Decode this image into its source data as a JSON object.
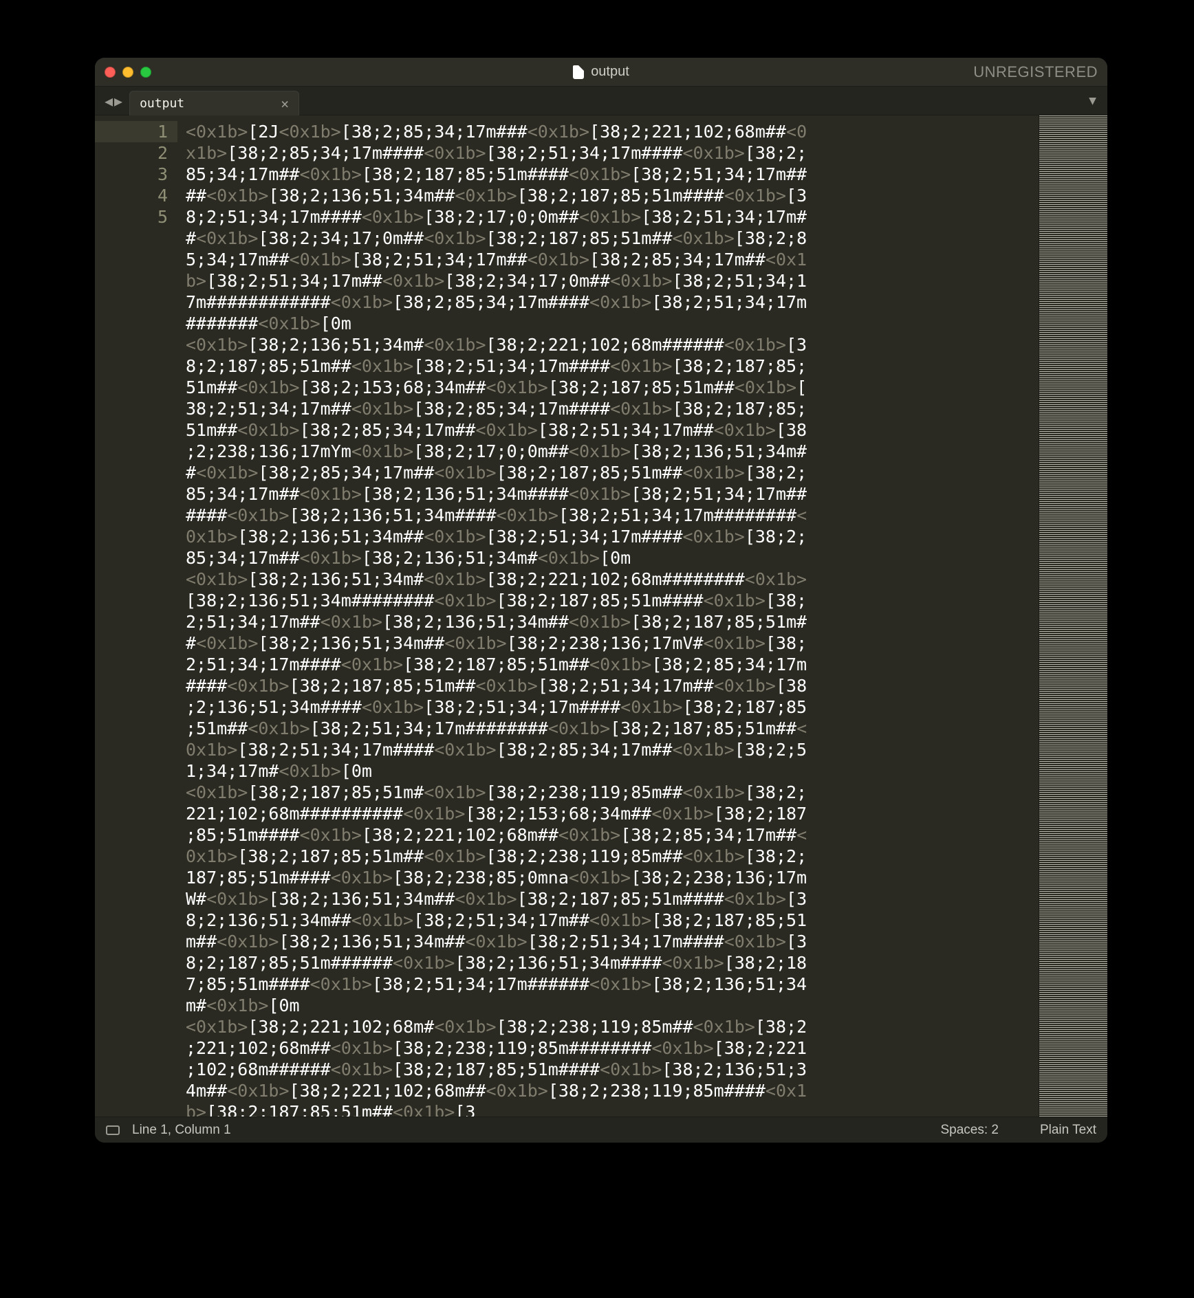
{
  "title": "output",
  "unregistered": "UNREGISTERED",
  "tab": {
    "label": "output",
    "close": "×"
  },
  "tabs_menu_glyph": "▼",
  "nav": {
    "back": "◀",
    "forward": "▶"
  },
  "status": {
    "position": "Line 1, Column 1",
    "spaces": "Spaces: 2",
    "syntax": "Plain Text"
  },
  "lines": [
    {
      "n": "1",
      "cursor": true,
      "segments": [
        {
          "t": "esc",
          "v": "<0x1b>"
        },
        {
          "t": "txt",
          "v": "[2J"
        },
        {
          "t": "esc",
          "v": "<0x1b>"
        },
        {
          "t": "txt",
          "v": "[38;2;85;34;17m###"
        },
        {
          "t": "esc",
          "v": "<0x1b>"
        },
        {
          "t": "txt",
          "v": "[38;2;221;102;68m##"
        },
        {
          "t": "esc",
          "v": "<0x1b>"
        },
        {
          "t": "txt",
          "v": "[38;2;85;34;17m####"
        },
        {
          "t": "esc",
          "v": "<0x1b>"
        },
        {
          "t": "txt",
          "v": "[38;2;51;34;17m####"
        },
        {
          "t": "esc",
          "v": "<0x1b>"
        },
        {
          "t": "txt",
          "v": "[38;2;85;34;17m##"
        },
        {
          "t": "esc",
          "v": "<0x1b>"
        },
        {
          "t": "txt",
          "v": "[38;2;187;85;51m####"
        },
        {
          "t": "esc",
          "v": "<0x1b>"
        },
        {
          "t": "txt",
          "v": "[38;2;51;34;17m####"
        },
        {
          "t": "esc",
          "v": "<0x1b>"
        },
        {
          "t": "txt",
          "v": "[38;2;136;51;34m##"
        },
        {
          "t": "esc",
          "v": "<0x1b>"
        },
        {
          "t": "txt",
          "v": "[38;2;187;85;51m####"
        },
        {
          "t": "esc",
          "v": "<0x1b>"
        },
        {
          "t": "txt",
          "v": "[38;2;51;34;17m####"
        },
        {
          "t": "esc",
          "v": "<0x1b>"
        },
        {
          "t": "txt",
          "v": "[38;2;17;0;0m##"
        },
        {
          "t": "esc",
          "v": "<0x1b>"
        },
        {
          "t": "txt",
          "v": "[38;2;51;34;17m##"
        },
        {
          "t": "esc",
          "v": "<0x1b>"
        },
        {
          "t": "txt",
          "v": "[38;2;34;17;0m##"
        },
        {
          "t": "esc",
          "v": "<0x1b>"
        },
        {
          "t": "txt",
          "v": "[38;2;187;85;51m##"
        },
        {
          "t": "esc",
          "v": "<0x1b>"
        },
        {
          "t": "txt",
          "v": "[38;2;85;34;17m##"
        },
        {
          "t": "esc",
          "v": "<0x1b>"
        },
        {
          "t": "txt",
          "v": "[38;2;51;34;17m##"
        },
        {
          "t": "esc",
          "v": "<0x1b>"
        },
        {
          "t": "txt",
          "v": "[38;2;85;34;17m##"
        },
        {
          "t": "esc",
          "v": "<0x1b>"
        },
        {
          "t": "txt",
          "v": "[38;2;51;34;17m##"
        },
        {
          "t": "esc",
          "v": "<0x1b>"
        },
        {
          "t": "txt",
          "v": "[38;2;34;17;0m##"
        },
        {
          "t": "esc",
          "v": "<0x1b>"
        },
        {
          "t": "txt",
          "v": "[38;2;51;34;17m############"
        },
        {
          "t": "esc",
          "v": "<0x1b>"
        },
        {
          "t": "txt",
          "v": "[38;2;85;34;17m####"
        },
        {
          "t": "esc",
          "v": "<0x1b>"
        },
        {
          "t": "txt",
          "v": "[38;2;51;34;17m#######"
        },
        {
          "t": "esc",
          "v": "<0x1b>"
        },
        {
          "t": "txt",
          "v": "[0m"
        }
      ]
    },
    {
      "n": "2",
      "segments": [
        {
          "t": "esc",
          "v": "<0x1b>"
        },
        {
          "t": "txt",
          "v": "[38;2;136;51;34m#"
        },
        {
          "t": "esc",
          "v": "<0x1b>"
        },
        {
          "t": "txt",
          "v": "[38;2;221;102;68m######"
        },
        {
          "t": "esc",
          "v": "<0x1b>"
        },
        {
          "t": "txt",
          "v": "[38;2;187;85;51m##"
        },
        {
          "t": "esc",
          "v": "<0x1b>"
        },
        {
          "t": "txt",
          "v": "[38;2;51;34;17m####"
        },
        {
          "t": "esc",
          "v": "<0x1b>"
        },
        {
          "t": "txt",
          "v": "[38;2;187;85;51m##"
        },
        {
          "t": "esc",
          "v": "<0x1b>"
        },
        {
          "t": "txt",
          "v": "[38;2;153;68;34m##"
        },
        {
          "t": "esc",
          "v": "<0x1b>"
        },
        {
          "t": "txt",
          "v": "[38;2;187;85;51m##"
        },
        {
          "t": "esc",
          "v": "<0x1b>"
        },
        {
          "t": "txt",
          "v": "[38;2;51;34;17m##"
        },
        {
          "t": "esc",
          "v": "<0x1b>"
        },
        {
          "t": "txt",
          "v": "[38;2;85;34;17m####"
        },
        {
          "t": "esc",
          "v": "<0x1b>"
        },
        {
          "t": "txt",
          "v": "[38;2;187;85;51m##"
        },
        {
          "t": "esc",
          "v": "<0x1b>"
        },
        {
          "t": "txt",
          "v": "[38;2;85;34;17m##"
        },
        {
          "t": "esc",
          "v": "<0x1b>"
        },
        {
          "t": "txt",
          "v": "[38;2;51;34;17m##"
        },
        {
          "t": "esc",
          "v": "<0x1b>"
        },
        {
          "t": "txt",
          "v": "[38;2;238;136;17mYm"
        },
        {
          "t": "esc",
          "v": "<0x1b>"
        },
        {
          "t": "txt",
          "v": "[38;2;17;0;0m##"
        },
        {
          "t": "esc",
          "v": "<0x1b>"
        },
        {
          "t": "txt",
          "v": "[38;2;136;51;34m##"
        },
        {
          "t": "esc",
          "v": "<0x1b>"
        },
        {
          "t": "txt",
          "v": "[38;2;85;34;17m##"
        },
        {
          "t": "esc",
          "v": "<0x1b>"
        },
        {
          "t": "txt",
          "v": "[38;2;187;85;51m##"
        },
        {
          "t": "esc",
          "v": "<0x1b>"
        },
        {
          "t": "txt",
          "v": "[38;2;85;34;17m##"
        },
        {
          "t": "esc",
          "v": "<0x1b>"
        },
        {
          "t": "txt",
          "v": "[38;2;136;51;34m####"
        },
        {
          "t": "esc",
          "v": "<0x1b>"
        },
        {
          "t": "txt",
          "v": "[38;2;51;34;17m######"
        },
        {
          "t": "esc",
          "v": "<0x1b>"
        },
        {
          "t": "txt",
          "v": "[38;2;136;51;34m####"
        },
        {
          "t": "esc",
          "v": "<0x1b>"
        },
        {
          "t": "txt",
          "v": "[38;2;51;34;17m########"
        },
        {
          "t": "esc",
          "v": "<0x1b>"
        },
        {
          "t": "txt",
          "v": "[38;2;136;51;34m##"
        },
        {
          "t": "esc",
          "v": "<0x1b>"
        },
        {
          "t": "txt",
          "v": "[38;2;51;34;17m####"
        },
        {
          "t": "esc",
          "v": "<0x1b>"
        },
        {
          "t": "txt",
          "v": "[38;2;85;34;17m##"
        },
        {
          "t": "esc",
          "v": "<0x1b>"
        },
        {
          "t": "txt",
          "v": "[38;2;136;51;34m#"
        },
        {
          "t": "esc",
          "v": "<0x1b>"
        },
        {
          "t": "txt",
          "v": "[0m"
        }
      ]
    },
    {
      "n": "3",
      "segments": [
        {
          "t": "esc",
          "v": "<0x1b>"
        },
        {
          "t": "txt",
          "v": "[38;2;136;51;34m#"
        },
        {
          "t": "esc",
          "v": "<0x1b>"
        },
        {
          "t": "txt",
          "v": "[38;2;221;102;68m########"
        },
        {
          "t": "esc",
          "v": "<0x1b>"
        },
        {
          "t": "txt",
          "v": "[38;2;136;51;34m########"
        },
        {
          "t": "esc",
          "v": "<0x1b>"
        },
        {
          "t": "txt",
          "v": "[38;2;187;85;51m####"
        },
        {
          "t": "esc",
          "v": "<0x1b>"
        },
        {
          "t": "txt",
          "v": "[38;2;51;34;17m##"
        },
        {
          "t": "esc",
          "v": "<0x1b>"
        },
        {
          "t": "txt",
          "v": "[38;2;136;51;34m##"
        },
        {
          "t": "esc",
          "v": "<0x1b>"
        },
        {
          "t": "txt",
          "v": "[38;2;187;85;51m##"
        },
        {
          "t": "esc",
          "v": "<0x1b>"
        },
        {
          "t": "txt",
          "v": "[38;2;136;51;34m##"
        },
        {
          "t": "esc",
          "v": "<0x1b>"
        },
        {
          "t": "txt",
          "v": "[38;2;238;136;17mV#"
        },
        {
          "t": "esc",
          "v": "<0x1b>"
        },
        {
          "t": "txt",
          "v": "[38;2;51;34;17m####"
        },
        {
          "t": "esc",
          "v": "<0x1b>"
        },
        {
          "t": "txt",
          "v": "[38;2;187;85;51m##"
        },
        {
          "t": "esc",
          "v": "<0x1b>"
        },
        {
          "t": "txt",
          "v": "[38;2;85;34;17m####"
        },
        {
          "t": "esc",
          "v": "<0x1b>"
        },
        {
          "t": "txt",
          "v": "[38;2;187;85;51m##"
        },
        {
          "t": "esc",
          "v": "<0x1b>"
        },
        {
          "t": "txt",
          "v": "[38;2;51;34;17m##"
        },
        {
          "t": "esc",
          "v": "<0x1b>"
        },
        {
          "t": "txt",
          "v": "[38;2;136;51;34m####"
        },
        {
          "t": "esc",
          "v": "<0x1b>"
        },
        {
          "t": "txt",
          "v": "[38;2;51;34;17m####"
        },
        {
          "t": "esc",
          "v": "<0x1b>"
        },
        {
          "t": "txt",
          "v": "[38;2;187;85;51m##"
        },
        {
          "t": "esc",
          "v": "<0x1b>"
        },
        {
          "t": "txt",
          "v": "[38;2;51;34;17m########"
        },
        {
          "t": "esc",
          "v": "<0x1b>"
        },
        {
          "t": "txt",
          "v": "[38;2;187;85;51m##"
        },
        {
          "t": "esc",
          "v": "<0x1b>"
        },
        {
          "t": "txt",
          "v": "[38;2;51;34;17m####"
        },
        {
          "t": "esc",
          "v": "<0x1b>"
        },
        {
          "t": "txt",
          "v": "[38;2;85;34;17m##"
        },
        {
          "t": "esc",
          "v": "<0x1b>"
        },
        {
          "t": "txt",
          "v": "[38;2;51;34;17m#"
        },
        {
          "t": "esc",
          "v": "<0x1b>"
        },
        {
          "t": "txt",
          "v": "[0m"
        }
      ]
    },
    {
      "n": "4",
      "segments": [
        {
          "t": "esc",
          "v": "<0x1b>"
        },
        {
          "t": "txt",
          "v": "[38;2;187;85;51m#"
        },
        {
          "t": "esc",
          "v": "<0x1b>"
        },
        {
          "t": "txt",
          "v": "[38;2;238;119;85m##"
        },
        {
          "t": "esc",
          "v": "<0x1b>"
        },
        {
          "t": "txt",
          "v": "[38;2;221;102;68m##########"
        },
        {
          "t": "esc",
          "v": "<0x1b>"
        },
        {
          "t": "txt",
          "v": "[38;2;153;68;34m##"
        },
        {
          "t": "esc",
          "v": "<0x1b>"
        },
        {
          "t": "txt",
          "v": "[38;2;187;85;51m####"
        },
        {
          "t": "esc",
          "v": "<0x1b>"
        },
        {
          "t": "txt",
          "v": "[38;2;221;102;68m##"
        },
        {
          "t": "esc",
          "v": "<0x1b>"
        },
        {
          "t": "txt",
          "v": "[38;2;85;34;17m##"
        },
        {
          "t": "esc",
          "v": "<0x1b>"
        },
        {
          "t": "txt",
          "v": "[38;2;187;85;51m##"
        },
        {
          "t": "esc",
          "v": "<0x1b>"
        },
        {
          "t": "txt",
          "v": "[38;2;238;119;85m##"
        },
        {
          "t": "esc",
          "v": "<0x1b>"
        },
        {
          "t": "txt",
          "v": "[38;2;187;85;51m####"
        },
        {
          "t": "esc",
          "v": "<0x1b>"
        },
        {
          "t": "txt",
          "v": "[38;2;238;85;0mna"
        },
        {
          "t": "esc",
          "v": "<0x1b>"
        },
        {
          "t": "txt",
          "v": "[38;2;238;136;17mW#"
        },
        {
          "t": "esc",
          "v": "<0x1b>"
        },
        {
          "t": "txt",
          "v": "[38;2;136;51;34m##"
        },
        {
          "t": "esc",
          "v": "<0x1b>"
        },
        {
          "t": "txt",
          "v": "[38;2;187;85;51m####"
        },
        {
          "t": "esc",
          "v": "<0x1b>"
        },
        {
          "t": "txt",
          "v": "[38;2;136;51;34m##"
        },
        {
          "t": "esc",
          "v": "<0x1b>"
        },
        {
          "t": "txt",
          "v": "[38;2;51;34;17m##"
        },
        {
          "t": "esc",
          "v": "<0x1b>"
        },
        {
          "t": "txt",
          "v": "[38;2;187;85;51m##"
        },
        {
          "t": "esc",
          "v": "<0x1b>"
        },
        {
          "t": "txt",
          "v": "[38;2;136;51;34m##"
        },
        {
          "t": "esc",
          "v": "<0x1b>"
        },
        {
          "t": "txt",
          "v": "[38;2;51;34;17m####"
        },
        {
          "t": "esc",
          "v": "<0x1b>"
        },
        {
          "t": "txt",
          "v": "[38;2;187;85;51m######"
        },
        {
          "t": "esc",
          "v": "<0x1b>"
        },
        {
          "t": "txt",
          "v": "[38;2;136;51;34m####"
        },
        {
          "t": "esc",
          "v": "<0x1b>"
        },
        {
          "t": "txt",
          "v": "[38;2;187;85;51m####"
        },
        {
          "t": "esc",
          "v": "<0x1b>"
        },
        {
          "t": "txt",
          "v": "[38;2;51;34;17m######"
        },
        {
          "t": "esc",
          "v": "<0x1b>"
        },
        {
          "t": "txt",
          "v": "[38;2;136;51;34m#"
        },
        {
          "t": "esc",
          "v": "<0x1b>"
        },
        {
          "t": "txt",
          "v": "[0m"
        }
      ]
    },
    {
      "n": "5",
      "segments": [
        {
          "t": "esc",
          "v": "<0x1b>"
        },
        {
          "t": "txt",
          "v": "[38;2;221;102;68m#"
        },
        {
          "t": "esc",
          "v": "<0x1b>"
        },
        {
          "t": "txt",
          "v": "[38;2;238;119;85m##"
        },
        {
          "t": "esc",
          "v": "<0x1b>"
        },
        {
          "t": "txt",
          "v": "[38;2;221;102;68m##"
        },
        {
          "t": "esc",
          "v": "<0x1b>"
        },
        {
          "t": "txt",
          "v": "[38;2;238;119;85m########"
        },
        {
          "t": "esc",
          "v": "<0x1b>"
        },
        {
          "t": "txt",
          "v": "[38;2;221;102;68m######"
        },
        {
          "t": "esc",
          "v": "<0x1b>"
        },
        {
          "t": "txt",
          "v": "[38;2;187;85;51m####"
        },
        {
          "t": "esc",
          "v": "<0x1b>"
        },
        {
          "t": "txt",
          "v": "[38;2;136;51;34m##"
        },
        {
          "t": "esc",
          "v": "<0x1b>"
        },
        {
          "t": "txt",
          "v": "[38;2;221;102;68m##"
        },
        {
          "t": "esc",
          "v": "<0x1b>"
        },
        {
          "t": "txt",
          "v": "[38;2;238;119;85m####"
        },
        {
          "t": "esc",
          "v": "<0x1b>"
        },
        {
          "t": "txt",
          "v": "[38;2;187;85;51m##"
        },
        {
          "t": "esc",
          "v": "<0x1b>"
        },
        {
          "t": "txt",
          "v": "[3"
        }
      ]
    }
  ]
}
